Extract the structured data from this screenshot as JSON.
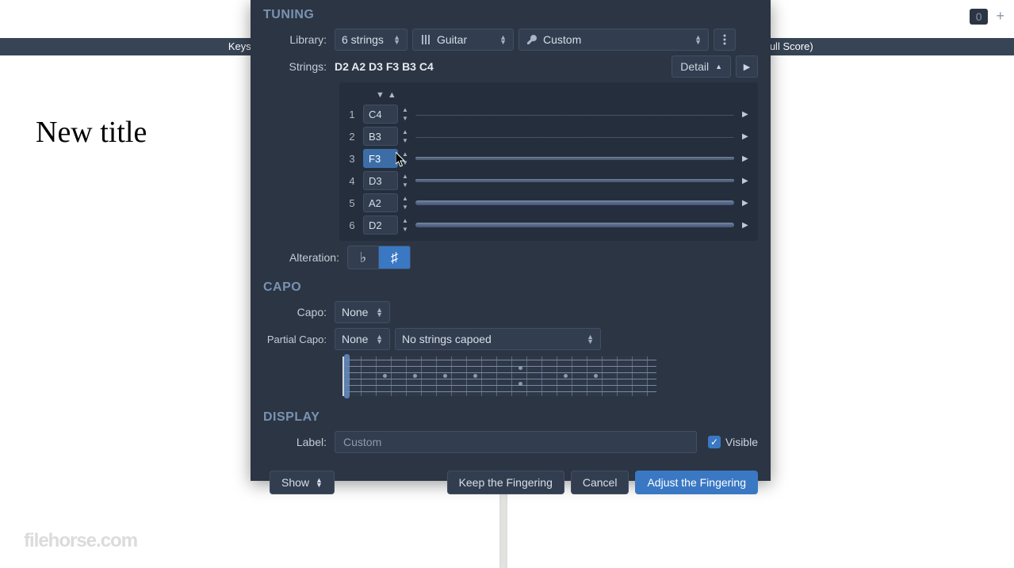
{
  "background": {
    "left_tab": "Keystone",
    "right_tab": "nderstruck (Full Score)",
    "title": "New title",
    "watermark": "filehorse.com"
  },
  "topcorner": {
    "num": "0"
  },
  "tuning": {
    "heading": "TUNING",
    "library_label": "Library:",
    "strings_count": "6 strings",
    "instrument": "Guitar",
    "tuning_name": "Custom",
    "strings_label": "Strings:",
    "strings_summary": "D2 A2 D3 F3 B3 C4",
    "detail_label": "Detail",
    "rows": [
      {
        "num": "1",
        "note": "C4",
        "thick": 0
      },
      {
        "num": "2",
        "note": "B3",
        "thick": 0
      },
      {
        "num": "3",
        "note": "F3",
        "thick": 1,
        "selected": true
      },
      {
        "num": "4",
        "note": "D3",
        "thick": 1
      },
      {
        "num": "5",
        "note": "A2",
        "thick": 2
      },
      {
        "num": "6",
        "note": "D2",
        "thick": 2
      }
    ],
    "alteration_label": "Alteration:",
    "flat": "♭",
    "sharp": "♯"
  },
  "capo": {
    "heading": "CAPO",
    "capo_label": "Capo:",
    "capo_value": "None",
    "partial_label": "Partial Capo:",
    "partial_value": "None",
    "partial_desc": "No strings capoed"
  },
  "display": {
    "heading": "DISPLAY",
    "label_label": "Label:",
    "label_value": "Custom",
    "visible_label": "Visible",
    "visible_checked": true
  },
  "footer": {
    "show": "Show",
    "keep": "Keep the Fingering",
    "cancel": "Cancel",
    "adjust": "Adjust the Fingering"
  }
}
